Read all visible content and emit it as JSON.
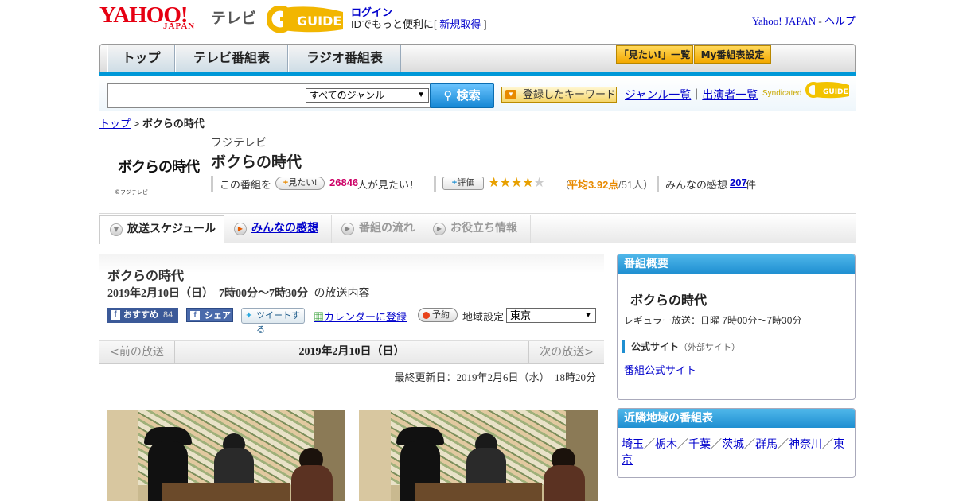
{
  "header": {
    "logo_yahoo": "YAHOO!",
    "logo_japan": "JAPAN",
    "logo_tv": "テレビ",
    "gguide_text": "GUIDE",
    "login_label": "ログイン",
    "login_msg_prefix": "IDでもっと便利に[",
    "signup_label": "新規取得",
    "login_msg_suffix": "]",
    "yahoo_japan_link": "Yahoo! JAPAN",
    "separator": " - ",
    "help_link": "ヘルプ"
  },
  "nav": {
    "tabs": [
      {
        "label": "トップ"
      },
      {
        "label": "テレビ番組表"
      },
      {
        "label": "ラジオ番組表"
      }
    ],
    "mitai_list": "「見たい!」一覧",
    "my_schedule": "My番組表設定"
  },
  "search": {
    "placeholder": "",
    "genre_selected": "すべてのジャンル",
    "search_button": "検索",
    "keyword_button": "登録したキーワード",
    "genre_list": "ジャンル一覧",
    "sep": "｜",
    "cast_list": "出演者一覧",
    "syndicated": "Syndicated"
  },
  "breadcrumb": {
    "top": "トップ",
    "sep": " > ",
    "current": "ボクらの時代"
  },
  "program": {
    "logo_text": "ボクらの時代",
    "logo_copyright": "©フジテレビ",
    "station": "フジテレビ",
    "title": "ボクらの時代",
    "want_prefix": "この番組を",
    "want_button": "見たい!",
    "want_count": "26846",
    "want_suffix": "人が見たい！",
    "rating_button": "評価",
    "rating_open": "（",
    "rating_avg_label": "平均3.92点",
    "rating_count": "/51人）",
    "rating_value": 3.92,
    "rating_max": 5,
    "impressions_prefix": "みんなの感想",
    "impressions_count": "207",
    "impressions_suffix": "件"
  },
  "tabs": [
    {
      "label": "放送スケジュール",
      "state": "active"
    },
    {
      "label": "みんなの感想",
      "state": "link"
    },
    {
      "label": "番組の流れ",
      "state": "disabled"
    },
    {
      "label": "お役立ち情報",
      "state": "disabled"
    }
  ],
  "broadcast": {
    "title": "ボクらの時代",
    "date_time": "2019年2月10日（日）　7時00分～7時30分",
    "date_suffix": "の放送内容",
    "fb_recommend": "おすすめ",
    "fb_recommend_count": "84",
    "fb_share": "シェア",
    "tweet": "ツイートする",
    "calendar": "カレンダーに登録",
    "reserve": "予約",
    "region_label": "地域設定",
    "region_selected": "東京",
    "prev": "<前の放送",
    "current_date": "2019年2月10日（日）",
    "next": "次の放送>",
    "updated": "最終更新日：2019年2月6日（水）　18時20分"
  },
  "overview": {
    "heading": "番組概要",
    "title": "ボクらの時代",
    "regular": "レギュラー放送：日曜 7時00分～7時30分",
    "official_label": "公式サイト",
    "official_note": "（外部サイト）",
    "official_link": "番組公式サイト"
  },
  "nearby": {
    "heading": "近隣地域の番組表",
    "regions": [
      "埼玉",
      "栃木",
      "千葉",
      "茨城",
      "群馬",
      "神奈川",
      "東京"
    ],
    "sep": "／"
  },
  "colors": {
    "accent_blue": "#0098d8",
    "yahoo_red": "#e60012",
    "want_count_color": "#cc0066",
    "rating_color": "#e88a00"
  }
}
